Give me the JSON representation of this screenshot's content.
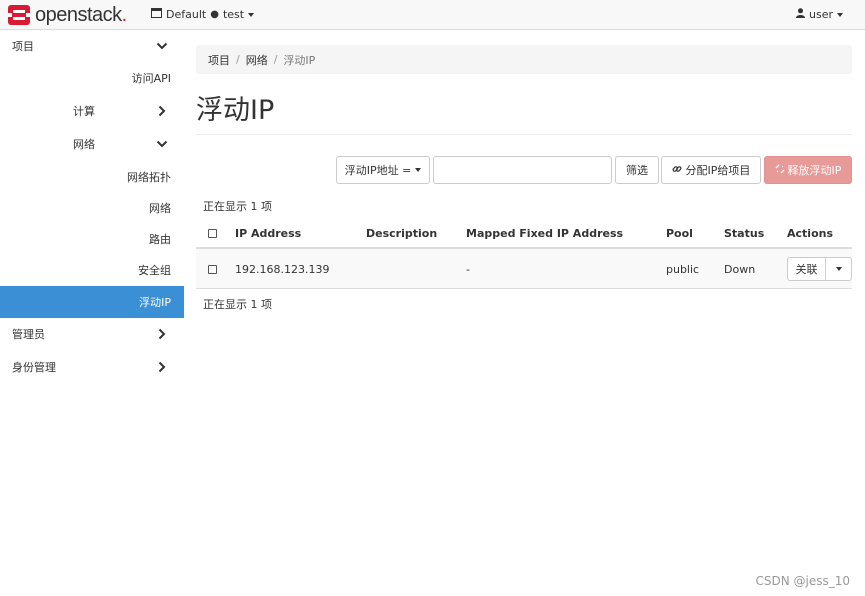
{
  "brand": {
    "name": "openstack",
    "dot": "."
  },
  "context": {
    "domain": "Default",
    "project": "test"
  },
  "user": {
    "name": "user"
  },
  "sidebar": {
    "project": "项目",
    "access_api": "访问API",
    "compute": "计算",
    "network": "网络",
    "network_topology": "网络拓扑",
    "networks": "网络",
    "routers": "路由",
    "security_groups": "安全组",
    "floating_ips": "浮动IP",
    "admin": "管理员",
    "identity": "身份管理"
  },
  "breadcrumb": {
    "item1": "项目",
    "item2": "网络",
    "current": "浮动IP",
    "sep": "/"
  },
  "page": {
    "title": "浮动IP"
  },
  "toolbar": {
    "filter_field": "浮动IP地址 =",
    "filter_value": "",
    "filter_button": "筛选",
    "allocate_button": "分配IP给项目",
    "release_button": "释放浮动IP"
  },
  "table": {
    "count_label": "正在显示 1 项",
    "columns": {
      "ip": "IP Address",
      "description": "Description",
      "mapped": "Mapped Fixed IP Address",
      "pool": "Pool",
      "status": "Status",
      "actions": "Actions"
    },
    "rows": [
      {
        "ip": "192.168.123.139",
        "description": "",
        "mapped": "-",
        "pool": "public",
        "status": "Down",
        "action": "关联"
      }
    ]
  },
  "watermark": "CSDN @jess_10",
  "colors": {
    "active": "#3b8fd4",
    "danger": "#e89a98",
    "brand": "#da1a32"
  }
}
